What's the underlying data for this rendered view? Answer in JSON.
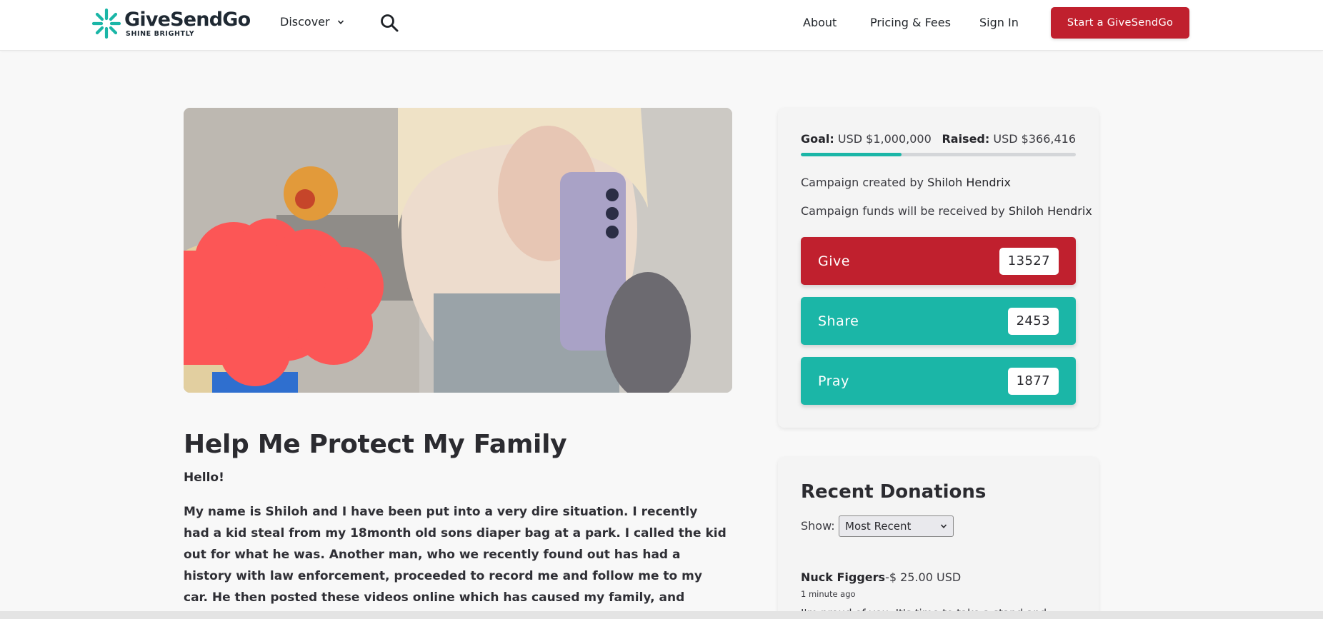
{
  "header": {
    "logo_name": "GiveSendGo",
    "logo_tagline": "SHINE BRIGHTLY",
    "discover_label": "Discover",
    "about_label": "About",
    "pricing_label": "Pricing & Fees",
    "signin_label": "Sign In",
    "start_label": "Start a GiveSendGo"
  },
  "campaign": {
    "title": "Help Me Protect My Family",
    "greeting": "Hello!",
    "story": "My name is Shiloh and I have been put into a very dire situation. I recently had a kid steal from my 18month old sons diaper bag at a park. I called the kid out for what he was. Another man, who we recently found out has had a history with law enforcement, proceeded to record me and follow me to my car. He then posted these videos online which has caused my family, and myself, great turmoil. My SSN has been leaked. My"
  },
  "summary": {
    "goal_label": "Goal:",
    "goal_value": "USD $1,000,000",
    "raised_label": "Raised:",
    "raised_value": "USD $366,416",
    "progress_fraction": 0.366,
    "created_prefix": "Campaign created by",
    "created_name": "Shiloh Hendrix",
    "received_prefix": "Campaign funds will be received by",
    "received_name": "Shiloh Hendrix",
    "give_label": "Give",
    "give_count": "13527",
    "share_label": "Share",
    "share_count": "2453",
    "pray_label": "Pray",
    "pray_count": "1877"
  },
  "donations": {
    "title": "Recent Donations",
    "show_label": "Show:",
    "show_selected": "Most Recent",
    "items": [
      {
        "name": "Nuck Figgers",
        "amount": "-$ 25.00 USD",
        "time": "1 minute ago",
        "message": "I'm proud of you. It's time to take a stand and"
      }
    ]
  },
  "colors": {
    "brand_red": "#c0202e",
    "brand_teal": "#1bb6a7"
  }
}
